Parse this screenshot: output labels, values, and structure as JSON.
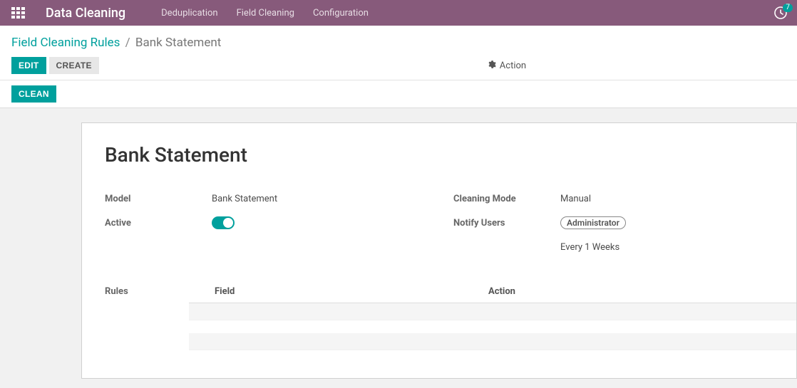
{
  "nav": {
    "app_title": "Data Cleaning",
    "items": [
      "Deduplication",
      "Field Cleaning",
      "Configuration"
    ],
    "badge_count": "7"
  },
  "breadcrumb": {
    "parent": "Field Cleaning Rules",
    "sep": "/",
    "current": "Bank Statement"
  },
  "buttons": {
    "edit": "Edit",
    "create": "Create",
    "action": "Action",
    "clean": "Clean"
  },
  "record": {
    "title": "Bank Statement",
    "labels": {
      "model": "Model",
      "active": "Active",
      "cleaning_mode": "Cleaning Mode",
      "notify_users": "Notify Users",
      "rules": "Rules"
    },
    "model": "Bank Statement",
    "cleaning_mode": "Manual",
    "notify_users": "Administrator",
    "notify_freq": "Every  1  Weeks",
    "rules_columns": {
      "field": "Field",
      "action": "Action"
    }
  }
}
